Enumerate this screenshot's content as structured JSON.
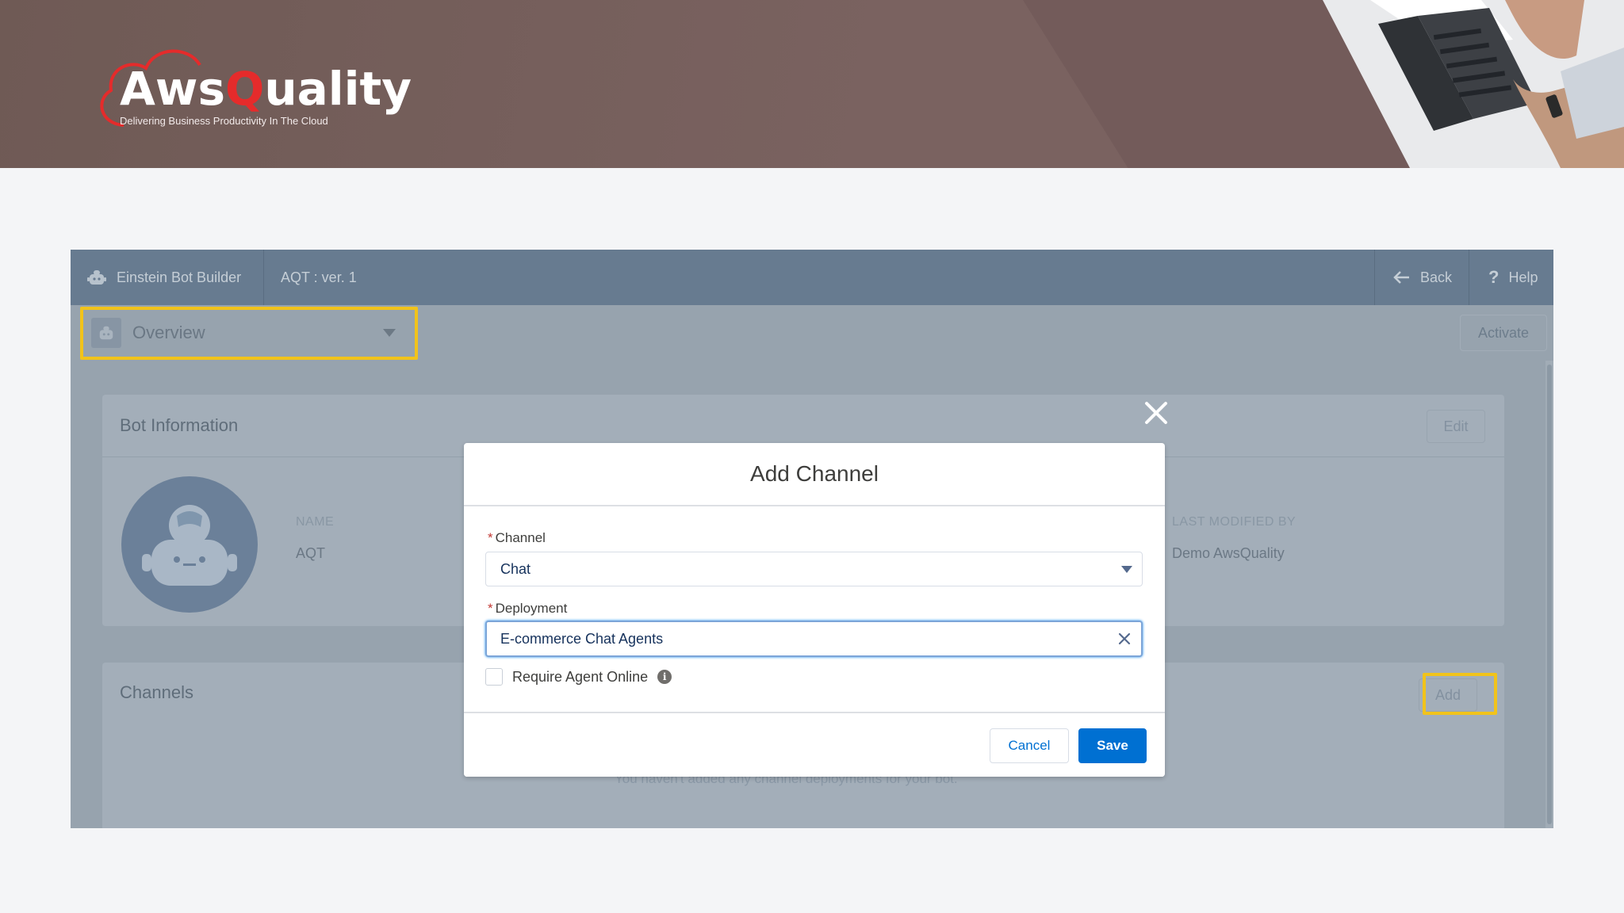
{
  "brand": {
    "logo_main_pre": "Aws",
    "logo_main_q": "Q",
    "logo_main_post": "uality",
    "logo_tagline": "Delivering Business Productivity In The Cloud",
    "logo_color": "#e52b2b",
    "highlight_color": "#f1c31b"
  },
  "topbar": {
    "app_name": "Einstein Bot Builder",
    "bot_version": "AQT : ver. 1",
    "back_label": "Back",
    "help_label": "Help"
  },
  "subbar": {
    "view_selected": "Overview",
    "activate_label": "Activate"
  },
  "bot_info": {
    "title": "Bot Information",
    "edit_label": "Edit",
    "name_label": "NAME",
    "name_value": "AQT",
    "last_modified_label": "LAST MODIFIED BY",
    "last_modified_value": "Demo AwsQuality"
  },
  "channels": {
    "title": "Channels",
    "add_label": "Add",
    "empty_message": "You haven't added any channel deployments for your bot."
  },
  "modal": {
    "title": "Add Channel",
    "channel_label": "Channel",
    "channel_value": "Chat",
    "deployment_label": "Deployment",
    "deployment_value": "E-commerce Chat Agents",
    "require_agent_label": "Require Agent Online",
    "require_agent_checked": false,
    "info_glyph": "i",
    "cancel_label": "Cancel",
    "save_label": "Save",
    "accent_color": "#0070d2"
  }
}
